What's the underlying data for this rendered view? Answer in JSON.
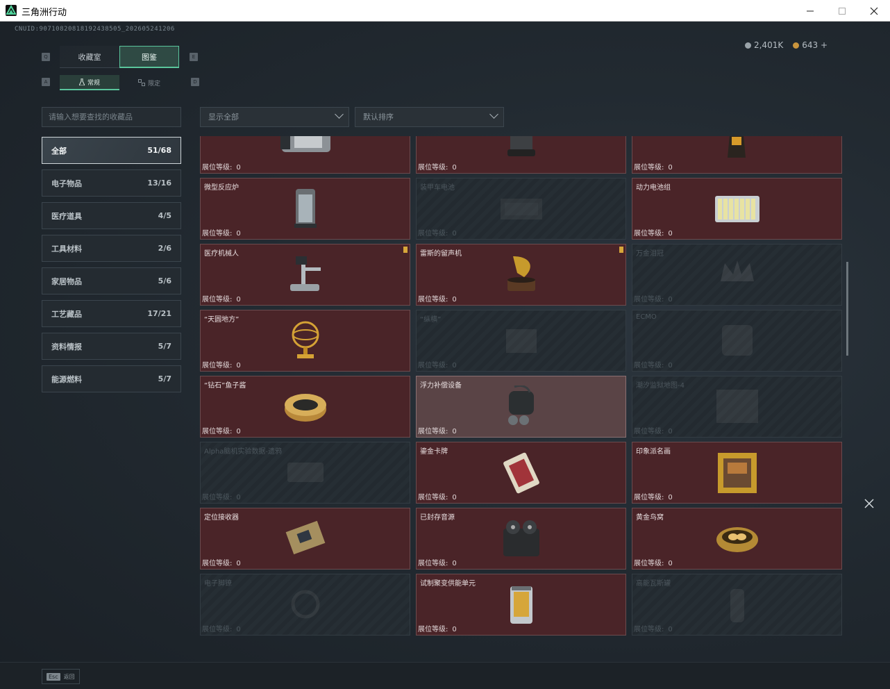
{
  "window": {
    "title": "三角洲行动"
  },
  "header": {
    "uid": "CNUID:90710820818192438505_202605241206",
    "currency": [
      {
        "value": "2,401K",
        "color": "#9aa3a9"
      },
      {
        "value": "643 +",
        "color": "#c9953d"
      }
    ]
  },
  "tabs": {
    "main": [
      {
        "label": "收藏室",
        "active": false
      },
      {
        "label": "图鉴",
        "active": true
      }
    ],
    "sub": [
      {
        "label": "常规",
        "icon": "flask-icon",
        "active": true
      },
      {
        "label": "限定",
        "icon": "grid-icon",
        "active": false
      }
    ],
    "key_hints": [
      "Q",
      "E",
      "A",
      "D"
    ]
  },
  "search": {
    "placeholder": "请输入想要查找的收藏品"
  },
  "filters": {
    "display": "显示全部",
    "sort": "默认排序"
  },
  "categories": [
    {
      "label": "全部",
      "count": "51/68",
      "active": true
    },
    {
      "label": "电子物品",
      "count": "13/16",
      "active": false
    },
    {
      "label": "医疗道具",
      "count": "4/5",
      "active": false
    },
    {
      "label": "工具材料",
      "count": "2/6",
      "active": false
    },
    {
      "label": "家居物品",
      "count": "5/6",
      "active": false
    },
    {
      "label": "工艺藏品",
      "count": "17/21",
      "active": false
    },
    {
      "label": "资料情报",
      "count": "5/7",
      "active": false
    },
    {
      "label": "能源燃料",
      "count": "5/7",
      "active": false
    }
  ],
  "level_label": "展位等级:",
  "items": [
    {
      "name": "",
      "level": "0",
      "locked": false,
      "art": "camera-icon"
    },
    {
      "name": "",
      "level": "0",
      "locked": false,
      "art": "coffee-machine-icon"
    },
    {
      "name": "",
      "level": "0",
      "locked": false,
      "art": "coffee-bag-icon"
    },
    {
      "name": "微型反应炉",
      "level": "0",
      "locked": false,
      "art": "reactor-icon"
    },
    {
      "name": "装甲车电池",
      "level": "0",
      "locked": true,
      "art": "battery-icon"
    },
    {
      "name": "动力电池组",
      "level": "0",
      "locked": false,
      "art": "battery-pack-icon"
    },
    {
      "name": "医疗机械人",
      "level": "0",
      "locked": false,
      "art": "robot-arm-icon",
      "badge": true
    },
    {
      "name": "雷斯的留声机",
      "level": "0",
      "locked": false,
      "art": "gramophone-icon",
      "badge": true
    },
    {
      "name": "万金泪冠",
      "level": "0",
      "locked": true,
      "art": "crown-icon"
    },
    {
      "name": "“天圆地方”",
      "level": "0",
      "locked": false,
      "art": "armillary-sphere-icon"
    },
    {
      "name": "“纵横”",
      "level": "0",
      "locked": true,
      "art": "board-icon"
    },
    {
      "name": "ECMO",
      "level": "0",
      "locked": true,
      "art": "machine-icon"
    },
    {
      "name": "“钻石”鱼子酱",
      "level": "0",
      "locked": false,
      "art": "caviar-tin-icon"
    },
    {
      "name": "浮力补偿设备",
      "level": "0",
      "locked": false,
      "art": "dive-gear-icon",
      "highlight": true
    },
    {
      "name": "潮汐监狱地图-4",
      "level": "0",
      "locked": true,
      "art": "map-icon"
    },
    {
      "name": "Alpha脑机实验数据-遗鸦",
      "level": "0",
      "locked": true,
      "art": "drive-icon"
    },
    {
      "name": "鎏金卡牌",
      "level": "0",
      "locked": false,
      "art": "card-icon"
    },
    {
      "name": "印象派名画",
      "level": "0",
      "locked": false,
      "art": "painting-icon"
    },
    {
      "name": "定位接收器",
      "level": "0",
      "locked": false,
      "art": "receiver-icon"
    },
    {
      "name": "已封存音源",
      "level": "0",
      "locked": false,
      "art": "tape-recorder-icon"
    },
    {
      "name": "黄金鸟窝",
      "level": "0",
      "locked": false,
      "art": "golden-nest-icon"
    },
    {
      "name": "电子脚镣",
      "level": "0",
      "locked": true,
      "art": "anklet-icon"
    },
    {
      "name": "试制聚变供能单元",
      "level": "0",
      "locked": false,
      "art": "fusion-cell-icon"
    },
    {
      "name": "高能瓦斯罐",
      "level": "0",
      "locked": true,
      "art": "gas-canister-icon"
    }
  ],
  "footer": {
    "esc_key": "Esc",
    "esc_label": "返回"
  }
}
